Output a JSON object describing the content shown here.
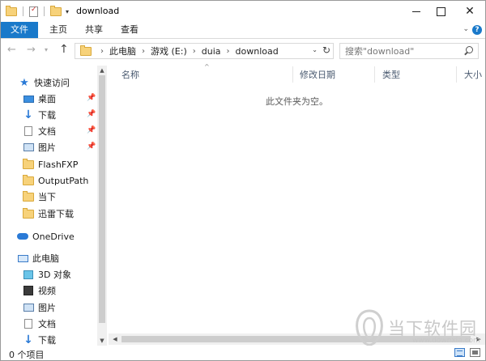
{
  "window": {
    "title": "download",
    "close_glyph": "✕"
  },
  "ribbon": {
    "tabs": [
      {
        "label": "文件"
      },
      {
        "label": "主页"
      },
      {
        "label": "共享"
      },
      {
        "label": "查看"
      }
    ],
    "help": "?"
  },
  "address": {
    "crumbs": [
      "此电脑",
      "游戏 (E:)",
      "duia",
      "download"
    ],
    "separator": "›"
  },
  "search": {
    "placeholder": "搜索\"download\""
  },
  "navpane": {
    "items": [
      {
        "label": "快速访问",
        "icon": "star-icon",
        "pinned": false
      },
      {
        "label": "桌面",
        "icon": "desktop-icon",
        "pinned": true
      },
      {
        "label": "下载",
        "icon": "download-arrow-icon",
        "pinned": true
      },
      {
        "label": "文档",
        "icon": "document-icon",
        "pinned": true
      },
      {
        "label": "图片",
        "icon": "pictures-icon",
        "pinned": true
      },
      {
        "label": "FlashFXP",
        "icon": "folder-icon",
        "pinned": false
      },
      {
        "label": "OutputPath",
        "icon": "folder-icon",
        "pinned": false
      },
      {
        "label": "当下",
        "icon": "folder-icon",
        "pinned": false
      },
      {
        "label": "迅雷下载",
        "icon": "folder-icon",
        "pinned": false
      },
      {
        "label": "OneDrive",
        "icon": "onedrive-icon",
        "pinned": false
      },
      {
        "label": "此电脑",
        "icon": "this-pc-icon",
        "pinned": false
      },
      {
        "label": "3D 对象",
        "icon": "3d-objects-icon",
        "pinned": false
      },
      {
        "label": "视频",
        "icon": "videos-icon",
        "pinned": false
      },
      {
        "label": "图片",
        "icon": "pictures-icon",
        "pinned": false
      },
      {
        "label": "文档",
        "icon": "document-icon",
        "pinned": false
      },
      {
        "label": "下载",
        "icon": "download-arrow-icon",
        "pinned": false
      }
    ]
  },
  "columns": [
    {
      "label": "名称"
    },
    {
      "label": "修改日期"
    },
    {
      "label": "类型"
    },
    {
      "label": "大小"
    }
  ],
  "content": {
    "empty_message": "此文件夹为空。"
  },
  "status": {
    "item_count": "0 个项目"
  },
  "watermark": {
    "text": "当下软件园",
    "url": "www.downxia.com"
  },
  "colors": {
    "accent": "#1979ca",
    "folder": "#f7d27a"
  }
}
